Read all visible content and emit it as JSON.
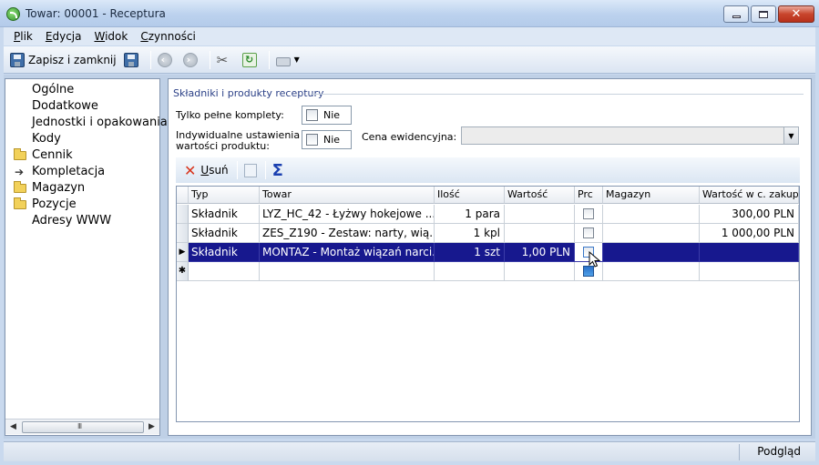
{
  "window": {
    "title": "Towar: 00001 - Receptura"
  },
  "menu": [
    {
      "label": "Plik",
      "ul": "P",
      "rest": "lik"
    },
    {
      "label": "Edycja",
      "ul": "E",
      "rest": "dycja"
    },
    {
      "label": "Widok",
      "ul": "W",
      "rest": "idok"
    },
    {
      "label": "Czynności",
      "ul": "C",
      "rest": "zynności"
    }
  ],
  "toolbar": {
    "save_close": "Zapisz i zamknij"
  },
  "nav": {
    "items": [
      {
        "label": "Ogólne",
        "icon": ""
      },
      {
        "label": "Dodatkowe",
        "icon": ""
      },
      {
        "label": "Jednostki i opakowania",
        "icon": ""
      },
      {
        "label": "Kody",
        "icon": ""
      },
      {
        "label": "Cennik",
        "icon": "folder-icon"
      },
      {
        "label": "Kompletacja",
        "icon": "arrow-icon"
      },
      {
        "label": "Magazyn",
        "icon": "folder-icon"
      },
      {
        "label": "Pozycje",
        "icon": "folder-icon"
      },
      {
        "label": "Adresy WWW",
        "icon": ""
      }
    ],
    "scroll_thumb": "III"
  },
  "section": {
    "title": "Składniki i produkty receptury"
  },
  "fields": {
    "tylko_label": "Tylko pełne komplety:",
    "tylko_value": "Nie",
    "indyw_label_1": "Indywidualne ustawienia",
    "indyw_label_2": "wartości produktu:",
    "indyw_value": "Nie",
    "cena_label": "Cena ewidencyjna:",
    "cena_value": ""
  },
  "gridbar": {
    "delete_label": "Usuń",
    "delete_ul": "U",
    "delete_rest": "suń"
  },
  "grid": {
    "columns": [
      "Typ",
      "Towar",
      "Ilość",
      "Wartość",
      "Prc",
      "Magazyn",
      "Wartość w c. zakupu"
    ],
    "rows": [
      {
        "typ": "Składnik",
        "towar": "LYZ_HC_42 - Łyżwy hokejowe ...",
        "ilosc": "1 para",
        "wartosc": "",
        "magazyn": "",
        "wartosc_zakupu": "300,00 PLN"
      },
      {
        "typ": "Składnik",
        "towar": "ZES_Z190 - Zestaw: narty, wią...",
        "ilosc": "1 kpl",
        "wartosc": "",
        "magazyn": "",
        "wartosc_zakupu": "1 000,00 PLN"
      },
      {
        "typ": "Składnik",
        "towar": "MONTAZ - Montaż wiązań narci...",
        "ilosc": "1 szt",
        "wartosc": "1,00 PLN",
        "magazyn": "",
        "wartosc_zakupu": ""
      }
    ]
  },
  "status": {
    "text": "Podgląd"
  }
}
